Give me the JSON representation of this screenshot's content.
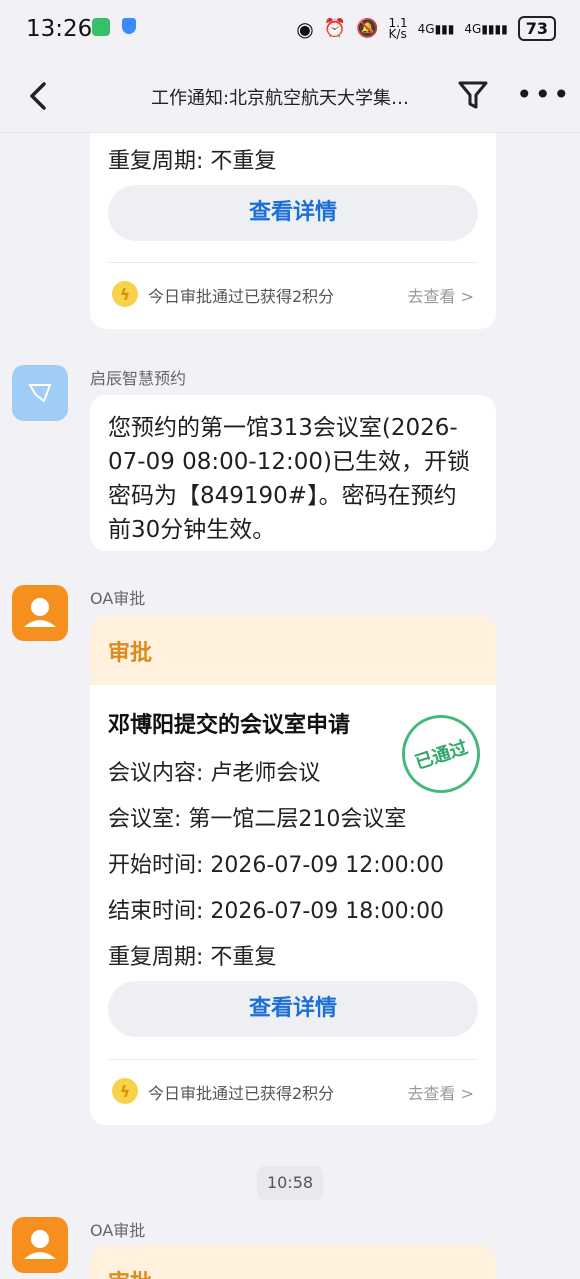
{
  "status": {
    "time": "13:26",
    "network_speed": "1.1\nK/s",
    "sig1": "4G",
    "sig2": "4G",
    "battery": "73"
  },
  "nav": {
    "title": "工作通知:北京航空航天大学集…"
  },
  "card_top": {
    "repeat": "重复周期: 不重复",
    "detail_btn": "查看详情",
    "points_text": "今日审批通过已获得2积分",
    "points_link": "去查看 >"
  },
  "msg_qichen": {
    "sender": "启辰智慧预约",
    "text": "您预约的第一馆313会议室(2026-07-09 08:00-12:00)已生效，开锁密码为【849190#】。密码在预约前30分钟生效。"
  },
  "msg_oa1": {
    "sender": "OA审批",
    "header": "审批",
    "title": "邓博阳提交的会议室申请",
    "stamp": "已通过",
    "fields": [
      "会议内容: 卢老师会议",
      "会议室: 第一馆二层210会议室",
      "开始时间: 2026-07-09 12:00:00",
      "结束时间: 2026-07-09 18:00:00",
      "重复周期: 不重复"
    ],
    "detail_btn": "查看详情",
    "points_text": "今日审批通过已获得2积分",
    "points_link": "去查看 >"
  },
  "time_divider": "10:58",
  "msg_oa2": {
    "sender": "OA审批",
    "header": "审批"
  }
}
